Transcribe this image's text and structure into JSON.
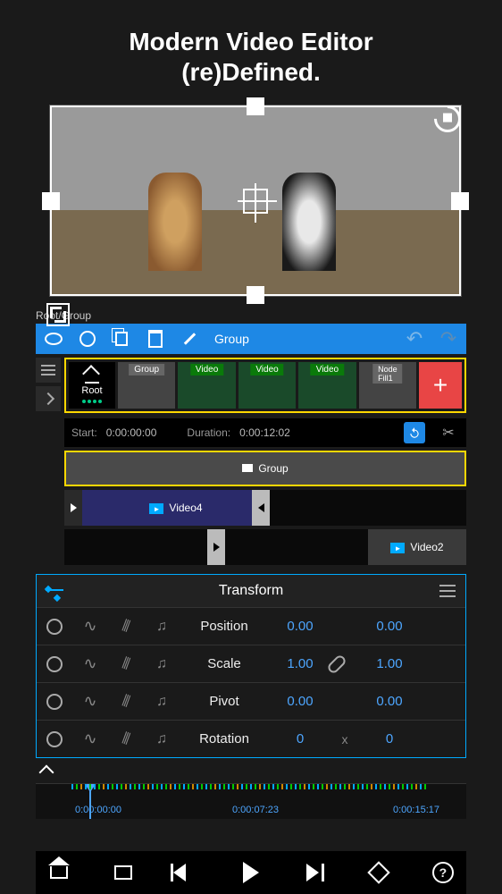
{
  "heading_line1": "Modern Video Editor",
  "heading_line2": "(re)Defined.",
  "breadcrumb": "Root/Group",
  "toolbar": {
    "label": "Group"
  },
  "layers": {
    "root": "Root",
    "tiles": [
      {
        "label": "Group",
        "style": "gray"
      },
      {
        "label": "Video",
        "style": "green"
      },
      {
        "label": "Video",
        "style": "green"
      },
      {
        "label": "Video",
        "style": "green"
      },
      {
        "label": "Node Fill1",
        "style": "gray"
      }
    ],
    "add": "+"
  },
  "meta": {
    "start_label": "Start:",
    "start_value": "0:00:00:00",
    "duration_label": "Duration:",
    "duration_value": "0:00:12:02"
  },
  "tracks": {
    "group": "Group",
    "video4": "Video4",
    "video2": "Video2"
  },
  "transform": {
    "title": "Transform",
    "rows": [
      {
        "label": "Position",
        "v1": "0.00",
        "mid": "",
        "v2": "0.00"
      },
      {
        "label": "Scale",
        "v1": "1.00",
        "mid": "link",
        "v2": "1.00"
      },
      {
        "label": "Pivot",
        "v1": "0.00",
        "mid": "",
        "v2": "0.00"
      },
      {
        "label": "Rotation",
        "v1": "0",
        "mid": "x",
        "v2": "0"
      }
    ]
  },
  "ruler": {
    "t0": "0:00:00:00",
    "t1": "0:00:07:23",
    "t2": "0:00:15:17"
  },
  "colors": {
    "accent_blue": "#1e88e5",
    "highlight": "#ffd700",
    "link_blue": "#4da6ff",
    "add_red": "#e84545"
  }
}
